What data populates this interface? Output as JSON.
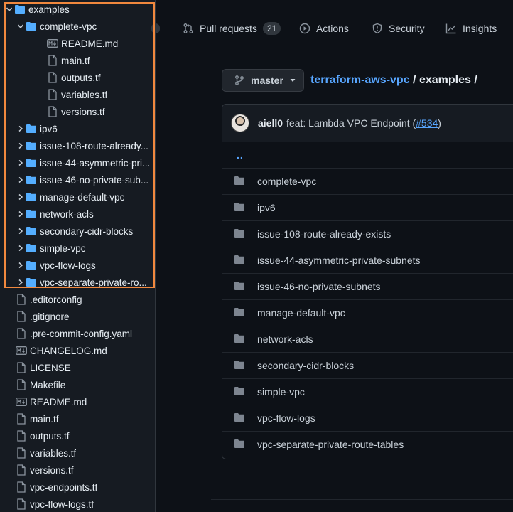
{
  "colors": {
    "background": "#0d1117",
    "panel": "#161b22",
    "folder_icon": "#54aeff",
    "link": "#58a6ff",
    "highlight_border": "#f0883e",
    "text": "#c9d1d9"
  },
  "tree": {
    "root": {
      "label": "examples",
      "icon": "folder-icon",
      "expanded": true
    },
    "open_folder": {
      "label": "complete-vpc",
      "icon": "folder-icon",
      "expanded": true
    },
    "open_folder_files": [
      {
        "label": "README.md",
        "icon": "markdown-icon"
      },
      {
        "label": "main.tf",
        "icon": "file-icon"
      },
      {
        "label": "outputs.tf",
        "icon": "file-icon"
      },
      {
        "label": "variables.tf",
        "icon": "file-icon"
      },
      {
        "label": "versions.tf",
        "icon": "file-icon"
      }
    ],
    "subfolders": [
      {
        "label": "ipv6"
      },
      {
        "label": "issue-108-route-already..."
      },
      {
        "label": "issue-44-asymmetric-pri..."
      },
      {
        "label": "issue-46-no-private-sub..."
      },
      {
        "label": "manage-default-vpc"
      },
      {
        "label": "network-acls"
      },
      {
        "label": "secondary-cidr-blocks"
      },
      {
        "label": "simple-vpc"
      },
      {
        "label": "vpc-flow-logs"
      },
      {
        "label": "vpc-separate-private-ro..."
      }
    ],
    "root_files": [
      {
        "label": ".editorconfig",
        "icon": "file-icon"
      },
      {
        "label": ".gitignore",
        "icon": "file-icon"
      },
      {
        "label": ".pre-commit-config.yaml",
        "icon": "file-icon"
      },
      {
        "label": "CHANGELOG.md",
        "icon": "markdown-icon"
      },
      {
        "label": "LICENSE",
        "icon": "file-icon"
      },
      {
        "label": "Makefile",
        "icon": "file-icon"
      },
      {
        "label": "README.md",
        "icon": "markdown-icon"
      },
      {
        "label": "main.tf",
        "icon": "file-icon"
      },
      {
        "label": "outputs.tf",
        "icon": "file-icon"
      },
      {
        "label": "variables.tf",
        "icon": "file-icon"
      },
      {
        "label": "versions.tf",
        "icon": "file-icon"
      },
      {
        "label": "vpc-endpoints.tf",
        "icon": "file-icon"
      },
      {
        "label": "vpc-flow-logs.tf",
        "icon": "file-icon"
      }
    ]
  },
  "nav": {
    "tabs": [
      {
        "label": "Pull requests",
        "icon": "pull-request-icon",
        "count": "21"
      },
      {
        "label": "Actions",
        "icon": "play-icon"
      },
      {
        "label": "Security",
        "icon": "shield-icon"
      },
      {
        "label": "Insights",
        "icon": "graph-icon"
      }
    ]
  },
  "branch": {
    "name": "master",
    "icon": "git-branch-icon"
  },
  "breadcrumb": {
    "repo": "terraform-aws-vpc",
    "sep1": " / ",
    "folder": "examples",
    "sep2": " /"
  },
  "commit": {
    "author": "aiell0",
    "message_prefix": "feat: Lambda VPC Endpoint (",
    "pr_ref": "#534",
    "message_suffix": ")"
  },
  "listing": {
    "parent_link": "..",
    "folders": [
      "complete-vpc",
      "ipv6",
      "issue-108-route-already-exists",
      "issue-44-asymmetric-private-subnets",
      "issue-46-no-private-subnets",
      "manage-default-vpc",
      "network-acls",
      "secondary-cidr-blocks",
      "simple-vpc",
      "vpc-flow-logs",
      "vpc-separate-private-route-tables"
    ]
  }
}
